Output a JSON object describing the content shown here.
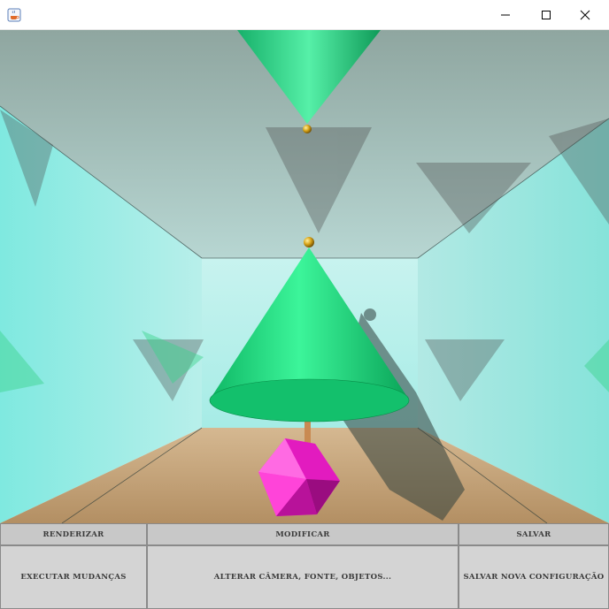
{
  "window": {
    "title": "",
    "icon": "java-cup-icon",
    "controls": {
      "minimize": "minimize-icon",
      "maximize": "maximize-icon",
      "close": "close-icon"
    }
  },
  "scene": {
    "description_icon": "raytraced-render",
    "colors": {
      "cone": "#1fe07a",
      "octahedron": "#ff2fd4",
      "wall": "#a8ece6",
      "floor": "#c9a77c",
      "sphere": "#d9a51a"
    }
  },
  "panel": {
    "columns": [
      {
        "header": "RENDERIZAR",
        "action": "EXECUTAR MUDANÇAS"
      },
      {
        "header": "MODIFICAR",
        "action": "ALTERAR CÂMERA, FONTE, OBJETOS..."
      },
      {
        "header": "SALVAR",
        "action": "SALVAR NOVA CONFIGURAÇÃO"
      }
    ]
  }
}
